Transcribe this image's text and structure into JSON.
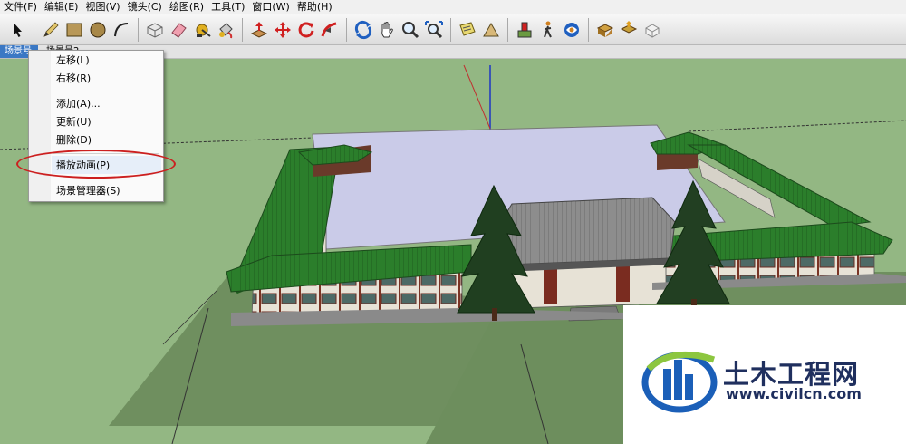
{
  "menubar": {
    "items": [
      "文件(F)",
      "编辑(E)",
      "视图(V)",
      "镜头(C)",
      "绘图(R)",
      "工具(T)",
      "窗口(W)",
      "帮助(H)"
    ]
  },
  "toolbar": {
    "icons": [
      "select-arrow-icon",
      "pencil-icon",
      "rectangle-icon",
      "circle-icon",
      "arc-icon",
      "make-component-icon",
      "eraser-icon",
      "tape-measure-icon",
      "paint-bucket-icon",
      "push-pull-icon",
      "move-icon",
      "rotate-icon",
      "follow-me-icon",
      "orbit-icon",
      "pan-hand-icon",
      "zoom-icon",
      "zoom-extents-icon",
      "text-label-icon",
      "dimension-icon",
      "walkthrough-position-icon",
      "walk-icon",
      "look-around-icon",
      "get-models-icon",
      "share-model-icon",
      "share-component-icon"
    ]
  },
  "tabs": {
    "active": "场景号1",
    "second": "场景号2"
  },
  "context_menu": {
    "items": [
      "左移(L)",
      "右移(R)",
      "添加(A)...",
      "更新(U)",
      "删除(D)",
      "播放动画(P)",
      "场景管理器(S)"
    ]
  },
  "colors": {
    "ground": "#93b783",
    "roof_green": "#2a7d2a",
    "courtyard": "#c8c9e6",
    "highlight_ring": "#cc1f1f",
    "watermark_text": "#1f2f5e"
  },
  "watermark": {
    "title": "土木工程网",
    "url": "www.civilcn.com"
  }
}
